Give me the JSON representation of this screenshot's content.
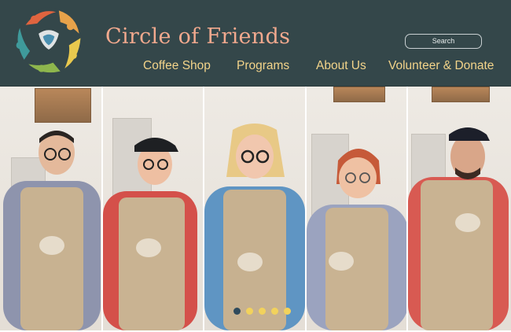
{
  "site": {
    "title": "Circle of Friends"
  },
  "search": {
    "placeholder": "Search"
  },
  "nav": {
    "items": [
      {
        "label": "Coffee Shop"
      },
      {
        "label": "Programs"
      },
      {
        "label": "About Us"
      },
      {
        "label": "Volunteer & Donate"
      }
    ]
  },
  "hero": {
    "photo_count": 5,
    "carousel": {
      "slide_count": 5,
      "active_index": 0
    }
  },
  "colors": {
    "header_bg": "#34474a",
    "title": "#f2a98e",
    "nav_link": "#f3d48a",
    "dot_active": "#2f4a5c",
    "dot_inactive": "#f2d25c",
    "apron": "#c9b392"
  },
  "icons": [
    "circle-of-friends-logo"
  ]
}
